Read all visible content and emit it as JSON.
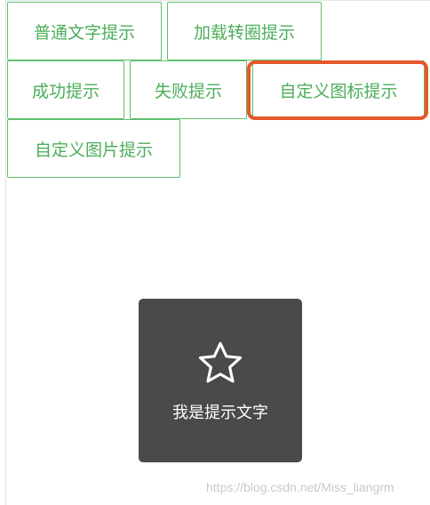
{
  "buttons": {
    "normal_text": "普通文字提示",
    "loading": "加载转圈提示",
    "success": "成功提示",
    "fail": "失败提示",
    "custom_icon": "自定义图标提示",
    "custom_image": "自定义图片提示"
  },
  "toast": {
    "icon": "star-outline-icon",
    "message": "我是提示文字"
  },
  "watermark": "https://blog.csdn.net/Miss_liangrm",
  "colors": {
    "button_border": "#5fbf6d",
    "button_text": "#4cae5a",
    "highlight": "#e5572c",
    "toast_bg": "#4a4a4a"
  }
}
